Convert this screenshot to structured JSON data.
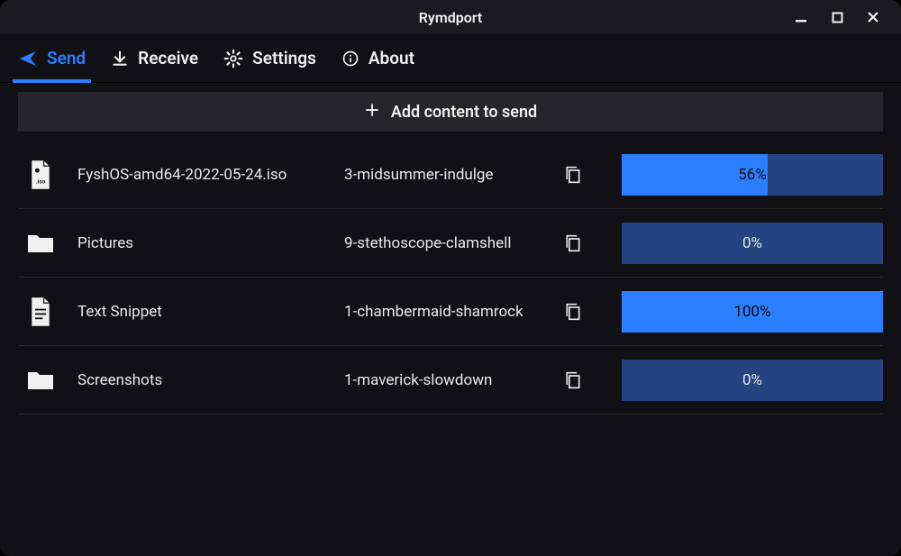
{
  "window": {
    "title": "Rymdport"
  },
  "tabs": [
    {
      "label": "Send",
      "icon": "send-icon",
      "active": true
    },
    {
      "label": "Receive",
      "icon": "download-icon",
      "active": false
    },
    {
      "label": "Settings",
      "icon": "gear-icon",
      "active": false
    },
    {
      "label": "About",
      "icon": "info-icon",
      "active": false
    }
  ],
  "add_button_label": "Add content to send",
  "items": [
    {
      "name": "FyshOS-amd64-2022-05-24.iso",
      "code": "3-midsummer-indulge",
      "progress": 56,
      "progress_label": "56%",
      "icon": "iso-file-icon"
    },
    {
      "name": "Pictures",
      "code": "9-stethoscope-clamshell",
      "progress": 0,
      "progress_label": "0%",
      "icon": "folder-icon"
    },
    {
      "name": "Text Snippet",
      "code": "1-chambermaid-shamrock",
      "progress": 100,
      "progress_label": "100%",
      "icon": "text-file-icon"
    },
    {
      "name": "Screenshots",
      "code": "1-maverick-slowdown",
      "progress": 0,
      "progress_label": "0%",
      "icon": "folder-icon"
    }
  ],
  "colors": {
    "accent": "#2b7fff",
    "progress_bg": "#244380"
  }
}
